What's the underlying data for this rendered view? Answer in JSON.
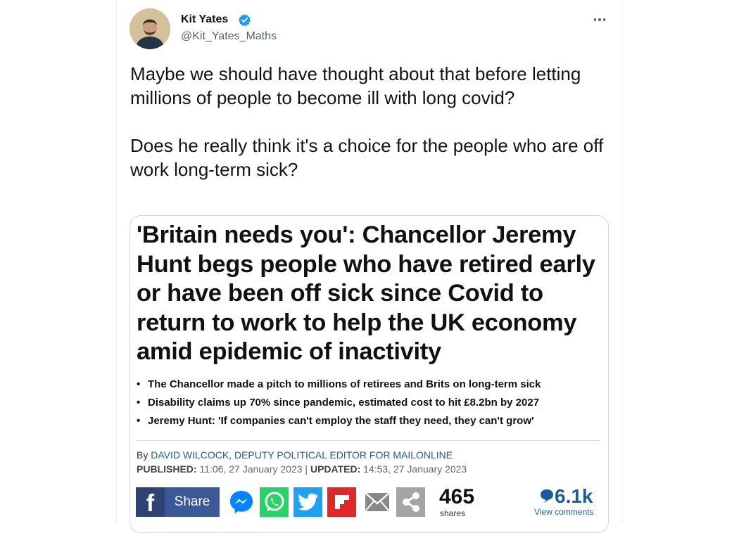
{
  "author": {
    "name": "Kit Yates",
    "handle": "@Kit_Yates_Maths",
    "verified": true
  },
  "tweet": {
    "paragraphs": [
      "Maybe we should have thought about that before letting millions of people to become ill with long covid?",
      "Does he really think it's a choice for the people who are off work long-term sick?"
    ]
  },
  "article": {
    "headline": "'Britain needs you': Chancellor Jeremy Hunt begs people who have retired early or have been off sick since Covid to return to work to help the UK economy amid epidemic of inactivity",
    "bullets": [
      "The Chancellor made a pitch to millions of retirees and Brits on long-term sick",
      "Disability claims up 70% since pandemic, estimated cost to hit £8.2bn by 2027",
      "Jeremy Hunt: 'If companies can't employ the staff they need, they can't grow'"
    ],
    "by_prefix": "By ",
    "author": "DAVID WILCOCK, DEPUTY POLITICAL EDITOR FOR MAILONLINE",
    "published_label": "PUBLISHED:",
    "published": " 11:06, 27 January 2023 | ",
    "updated_label": "UPDATED:",
    "updated": " 14:53, 27 January 2023"
  },
  "share_bar": {
    "facebook_glyph": "f",
    "facebook_label": "Share",
    "icons": [
      "messenger-icon",
      "whatsapp-icon",
      "twitter-icon",
      "flipboard-icon",
      "email-icon",
      "share-icon"
    ],
    "share_count": "465",
    "shares_label": "shares",
    "comment_count": "6.1k",
    "comments_label": "View comments"
  },
  "colors": {
    "verified": "#1d9bf0",
    "facebook": "#3b5998",
    "messenger": "#0084ff",
    "whatsapp": "#25d366",
    "twitter": "#1da1f2",
    "flipboard": "#e12828",
    "email": "#888888",
    "share": "#a4a4a4",
    "link": "#1d5c9a"
  }
}
